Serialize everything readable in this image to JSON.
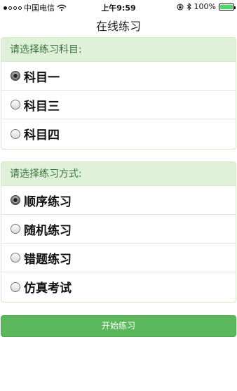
{
  "status_bar": {
    "carrier": "中国电信",
    "time": "上午9:59",
    "battery_text": "100%",
    "battery_level": 1.0,
    "accent_green": "#4cd964"
  },
  "nav": {
    "title": "在线练习"
  },
  "subject_panel": {
    "heading": "请选择练习科目:",
    "options": [
      {
        "label": "科目一",
        "checked": true
      },
      {
        "label": "科目三",
        "checked": false
      },
      {
        "label": "科目四",
        "checked": false
      }
    ]
  },
  "mode_panel": {
    "heading": "请选择练习方式:",
    "options": [
      {
        "label": "顺序练习",
        "checked": true
      },
      {
        "label": "随机练习",
        "checked": false
      },
      {
        "label": "错题练习",
        "checked": false
      },
      {
        "label": "仿真考试",
        "checked": false
      }
    ]
  },
  "start_button": {
    "label": "开始练习",
    "color": "#5cb85c"
  },
  "colors": {
    "panel_heading_bg": "#dff0d8",
    "panel_heading_text": "#3c763d"
  }
}
